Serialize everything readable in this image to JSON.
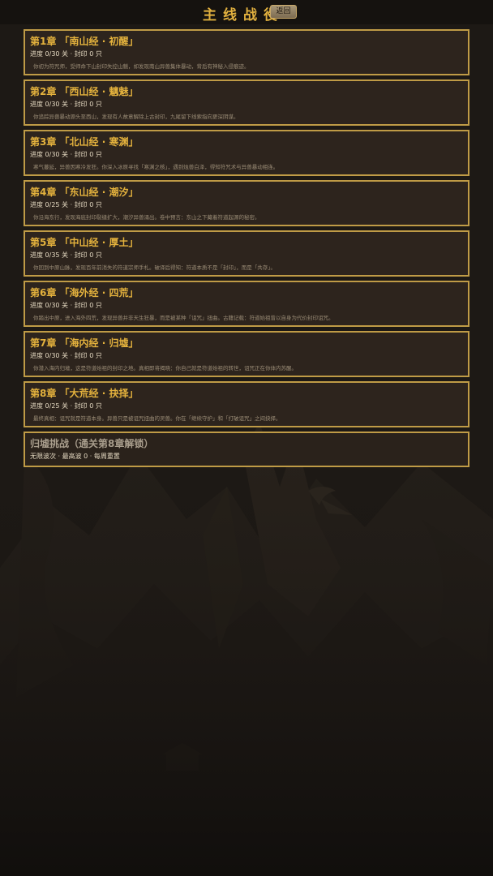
{
  "header": {
    "title": "主线战役",
    "back_label": "返回"
  },
  "chapters": [
    {
      "title": "第1章 「南山经 · 初醒」",
      "status": "进度 0/30 关 · 封印 0 只",
      "description": "你初为符咒师，受师命下山封印失控山魈，却发现南山异兽集体暴动，背后有神秘入侵痕迹。"
    },
    {
      "title": "第2章 「西山经 · 魑魅」",
      "status": "进度 0/30 关 · 封印 0 只",
      "description": "你追踪异兽暴动源头至西山，发现有人故意解除上古封印，九尾留下线索指向更深阴谋。"
    },
    {
      "title": "第3章 「北山经 · 寒渊」",
      "status": "进度 0/30 关 · 封印 0 只",
      "description": "寒气蔓延，异兽因寒冷发狂。你深入冰原寻找「寒渊之核」，遇到烛兽白泽，得知符咒术与异兽暴动相连。"
    },
    {
      "title": "第4章 「东山经 · 潮汐」",
      "status": "进度 0/25 关 · 封印 0 只",
      "description": "你沿海东行，发现海底封印裂缝扩大，潮汐异兽涌出。卷中预言：东山之下藏着符道起源的秘密。"
    },
    {
      "title": "第5章 「中山经 · 厚土」",
      "status": "进度 0/35 关 · 封印 0 只",
      "description": "你回到中原山脉，发现百年前消失的符道宗师手札。破译后得知：符道本质不是「封印」，而是「共存」。"
    },
    {
      "title": "第6章 「海外经 · 四荒」",
      "status": "进度 0/30 关 · 封印 0 只",
      "description": "你踏出中原，进入海外四荒，发现异兽并非天生狂暴，而是被某种「诅咒」扭曲。古籍记载：符道始祖曾以自身为代价封印诅咒。"
    },
    {
      "title": "第7章 「海内经 · 归墟」",
      "status": "进度 0/30 关 · 封印 0 只",
      "description": "你潜入海内归墟，这是符道始祖的封印之地。真相即将揭晓：你自己就是符道始祖的转世，诅咒正在你体内苏醒。"
    },
    {
      "title": "第8章 「大荒经 · 抉择」",
      "status": "进度 0/25 关 · 封印 0 只",
      "description": "最终真相：诅咒就是符道本身。异兽只是被诅咒扭曲的灵兽。你在「继续守护」和「打破诅咒」之间抉择。"
    }
  ],
  "challenge": {
    "title": "归墟挑战（通关第8章解锁）",
    "status": "无限波次 · 最高波 0 · 每周重置"
  }
}
